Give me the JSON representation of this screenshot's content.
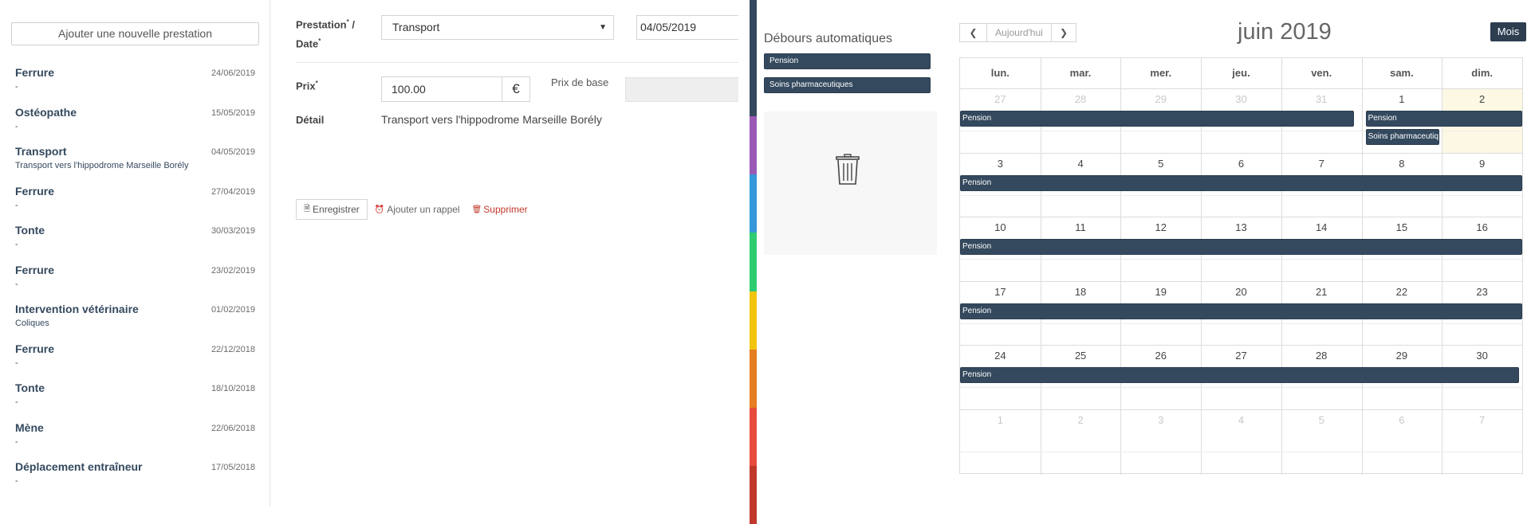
{
  "list_panel": {
    "add_button": "Ajouter une nouvelle prestation",
    "items": [
      {
        "title": "Ferrure",
        "sub": "-",
        "date": "24/06/2019"
      },
      {
        "title": "Ostéopathe",
        "sub": "-",
        "date": "15/05/2019"
      },
      {
        "title": "Transport",
        "sub": "Transport vers l'hippodrome Marseille Borély",
        "date": "04/05/2019"
      },
      {
        "title": "Ferrure",
        "sub": "-",
        "date": "27/04/2019"
      },
      {
        "title": "Tonte",
        "sub": "-",
        "date": "30/03/2019"
      },
      {
        "title": "Ferrure",
        "sub": "-",
        "date": "23/02/2019"
      },
      {
        "title": "Intervention vétérinaire",
        "sub": "Coliques",
        "date": "01/02/2019"
      },
      {
        "title": "Ferrure",
        "sub": "-",
        "date": "22/12/2018"
      },
      {
        "title": "Tonte",
        "sub": "-",
        "date": "18/10/2018"
      },
      {
        "title": "Mène",
        "sub": "-",
        "date": "22/06/2018"
      },
      {
        "title": "Déplacement entraîneur",
        "sub": "-",
        "date": "17/05/2018"
      }
    ]
  },
  "detail_form": {
    "prestation_label": "Prestation",
    "date_label": "Date",
    "required_mark": "*",
    "slash": " /",
    "prestation_value": "Transport",
    "date_value": "04/05/2019",
    "prix_label": "Prix",
    "prix_value": "100.00",
    "currency": "€",
    "base_price_label": "Prix de base",
    "detail_label": "Détail",
    "detail_value": "Transport vers l'hippodrome Marseille Borély",
    "save_button": "Enregistrer",
    "reminder_button": "Ajouter un rappel",
    "delete_button": "Supprimer"
  },
  "color_strip": [
    "#34495e",
    "#34495e",
    "#9b59b6",
    "#3498db",
    "#2ecc71",
    "#f1c40f",
    "#e67e22",
    "#e74c3c",
    "#c0392b"
  ],
  "automatic_disbursements": {
    "title": "Débours automatiques",
    "events": [
      "Pension",
      "Soins pharmaceutiques"
    ]
  },
  "calendar": {
    "prev_icon": "chevron-left-icon",
    "next_icon": "chevron-right-icon",
    "today_button": "Aujourd'hui",
    "title": "juin 2019",
    "view_button": "Mois",
    "weekdays": [
      "lun.",
      "mar.",
      "mer.",
      "jeu.",
      "ven.",
      "sam.",
      "dim."
    ],
    "weeks": [
      [
        {
          "d": "27",
          "o": true
        },
        {
          "d": "28",
          "o": true
        },
        {
          "d": "29",
          "o": true
        },
        {
          "d": "30",
          "o": true
        },
        {
          "d": "31",
          "o": true
        },
        {
          "d": "1"
        },
        {
          "d": "2",
          "today": true
        }
      ],
      [
        {
          "d": "3"
        },
        {
          "d": "4"
        },
        {
          "d": "5"
        },
        {
          "d": "6"
        },
        {
          "d": "7"
        },
        {
          "d": "8"
        },
        {
          "d": "9"
        }
      ],
      [
        {
          "d": "10"
        },
        {
          "d": "11"
        },
        {
          "d": "12"
        },
        {
          "d": "13"
        },
        {
          "d": "14"
        },
        {
          "d": "15"
        },
        {
          "d": "16"
        }
      ],
      [
        {
          "d": "17"
        },
        {
          "d": "18"
        },
        {
          "d": "19"
        },
        {
          "d": "20"
        },
        {
          "d": "21"
        },
        {
          "d": "22"
        },
        {
          "d": "23"
        }
      ],
      [
        {
          "d": "24"
        },
        {
          "d": "25"
        },
        {
          "d": "26"
        },
        {
          "d": "27"
        },
        {
          "d": "28"
        },
        {
          "d": "29"
        },
        {
          "d": "30"
        }
      ],
      [
        {
          "d": "1",
          "o": true
        },
        {
          "d": "2",
          "o": true
        },
        {
          "d": "3",
          "o": true
        },
        {
          "d": "4",
          "o": true
        },
        {
          "d": "5",
          "o": true
        },
        {
          "d": "6",
          "o": true
        },
        {
          "d": "7",
          "o": true
        }
      ]
    ],
    "events": [
      {
        "label": "Pension",
        "week": 0,
        "start": 0,
        "end": 4,
        "slot": 0
      },
      {
        "label": "Pension",
        "week": 0,
        "start": 5,
        "end": 6,
        "slot": 0
      },
      {
        "label": "Soins pharmaceutiques",
        "week": 0,
        "start": 5,
        "end": 5,
        "slot": 1
      },
      {
        "label": "Pension",
        "week": 1,
        "start": 0,
        "end": 6,
        "slot": 0
      },
      {
        "label": "Pension",
        "week": 2,
        "start": 0,
        "end": 6,
        "slot": 0
      },
      {
        "label": "Pension",
        "week": 3,
        "start": 0,
        "end": 6,
        "slot": 0
      },
      {
        "label": "Pension",
        "week": 4,
        "start": 0,
        "end": 6,
        "slot": 0
      }
    ]
  }
}
